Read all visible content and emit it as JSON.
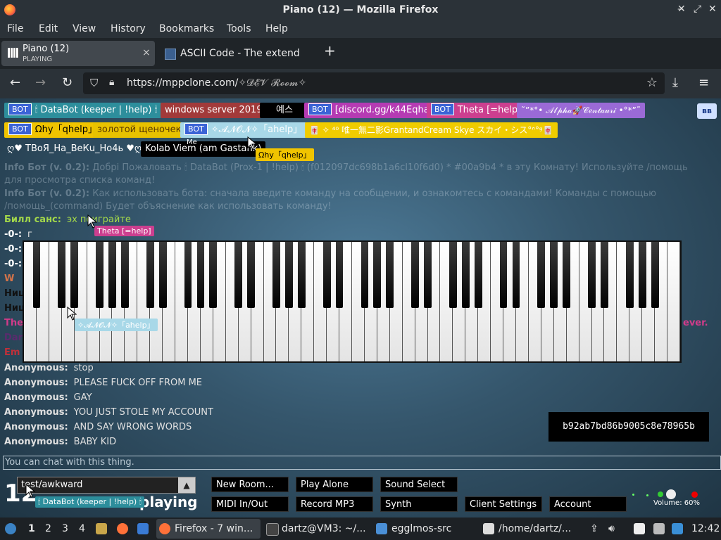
{
  "window": {
    "title": "Piano (12) — Mozilla Firefox"
  },
  "menu": [
    "File",
    "Edit",
    "View",
    "History",
    "Bookmarks",
    "Tools",
    "Help"
  ],
  "tabs": [
    {
      "label": "Piano (12)",
      "sub": "PLAYING",
      "close": "×"
    },
    {
      "label": "ASCII Code - The extended"
    }
  ],
  "newtab": "+",
  "url": {
    "host": "https://mppclone.com/",
    "path": "✧𝓓𝓔𝓥 𝓡𝓸𝓸𝓶✧"
  },
  "translate_badge": "ʙʙ",
  "nametags": [
    {
      "text": "🕯 DataBot (keeper | !help) 🕯",
      "bot": true,
      "bg": "#2d8e9c",
      "fg": "#ffffff"
    },
    {
      "text": "windows server 2019",
      "bot": false,
      "bg": "#a23a3a",
      "fg": "#ffffff"
    },
    {
      "text": "예스",
      "bot": false,
      "bg": "#000000",
      "fg": "#ffffff"
    },
    {
      "text": "[discord.gg/k44Eqha]",
      "bot": true,
      "bg": "#b53bb3",
      "fg": "#ffffff"
    },
    {
      "text": "Theta [=help]",
      "bot": true,
      "bg": "#cc3f8f",
      "fg": "#ffffff"
    },
    {
      "text": "˜”*°• 𝒜𝓁𝓅𝒽𝒶🚀𝒞𝑒𝓃𝓉𝒶𝓊𝓇𝒾 •°*”˜",
      "bot": false,
      "bg": "#9a6ad6",
      "fg": "#ffffff"
    },
    {
      "text": "Ωhy「qhelp」",
      "bot": true,
      "bg": "#f0c400",
      "fg": "#000000"
    },
    {
      "text": "золотой щеночек",
      "bot": false,
      "bg": "#e8c200",
      "fg": "#5a3a00"
    },
    {
      "text": "✧𝓐𝓝𝓞𝓝✧「ahelp」",
      "bot": true,
      "bg": "#a8d8e8",
      "fg": "#ffffff"
    },
    {
      "text": "🀄 ✧ ⁴⁰ 唯一無二影GrantandCream Skye スカイ・シス°ᐢ°ᵍ🀄",
      "bot": false,
      "bg": "#f0cc00",
      "fg": "#ffffff"
    },
    {
      "text": "ღ♥ ТВоЯ_На_ВеКu_Но4ь ♥ღ",
      "bot": false,
      "bg": "transparent",
      "fg": "#ffffff"
    },
    {
      "text": "Kolab Viem (am Gastank)",
      "bot": false,
      "bg": "#000000",
      "fg": "#ffffff"
    }
  ],
  "me_label": "Me",
  "cursor_tags": [
    {
      "text": "Ωhy「qhelp」",
      "bg": "#f0c400",
      "fg": "#000000"
    },
    {
      "text": "Theta [=help]",
      "bg": "#cc3f8f",
      "fg": "#ffffff"
    },
    {
      "text": "✧𝓐𝓝𝓞𝓝✧「ahelp」",
      "bg": "#a8d8e8",
      "fg": "#ffffff"
    },
    {
      "text": "🕯 DataBot (keeper | !help) 🕯",
      "bg": "#2d8e9c",
      "fg": "#ffffff"
    }
  ],
  "ghost_chat": [
    {
      "name": "Info Бот (v. 0.2):",
      "text": "Добрі Пожаловать 🕯 DataBot (Prox-1 | !help) 🕯 (f012097dc698b1a6cl10f6d0) * #00a9b4 * в эту Комнату! Используйте /помощь"
    },
    {
      "name": "",
      "text": "для просмотра списка команд!"
    },
    {
      "name": "Info Бот (v. 0.2):",
      "text": "Как использовать бота: сначала введите команду на сообщении, и ознакомтесь с командами! Команды с помощью"
    },
    {
      "name": "",
      "text": "/помощь_(command) Будет объяснение как использовать команду!"
    }
  ],
  "chat_above": [
    {
      "name": "Билл санс:",
      "text": "эх поиграйте",
      "color": "#a3d84a"
    },
    {
      "name": "-0-:",
      "text": "г",
      "color": "#ffffff"
    },
    {
      "name": "-0-:",
      "text": "",
      "color": "#ffffff"
    },
    {
      "name": "-0-:",
      "text": "",
      "color": "#ffffff"
    },
    {
      "name": "W",
      "text": "",
      "color": "#d5744a"
    },
    {
      "name": "Ниц",
      "text": "",
      "color": "#111111"
    },
    {
      "name": "Ниц",
      "text": "",
      "color": "#111111"
    },
    {
      "name": "The",
      "text": "",
      "color": "#d23b8a"
    },
    {
      "name": "Dar",
      "text": "",
      "color": "#5b2a6e"
    },
    {
      "name": "Em",
      "text": "",
      "color": "#c0303a"
    }
  ],
  "chat_right_fragment": "ever.",
  "chat": [
    {
      "name": "Anonymous:",
      "text": "stop"
    },
    {
      "name": "Anonymous:",
      "text": "PLEASE FUCK OFF FROM ME"
    },
    {
      "name": "Anonymous:",
      "text": "GAY"
    },
    {
      "name": "Anonymous:",
      "text": "YOU JUST STOLE MY ACCOUNT"
    },
    {
      "name": "Anonymous:",
      "text": "AND SAY WRONG WORDS"
    },
    {
      "name": "Anonymous:",
      "text": "BABY KID"
    }
  ],
  "user_id": "b92ab7bd86b9005c8e78965b",
  "chat_placeholder": "You can chat with this thing.",
  "player_count": "12",
  "playing_text": "playing",
  "room_select": {
    "value": "test/awkward",
    "arrow": "▲"
  },
  "buttons": {
    "new_room": "New Room...",
    "play_alone": "Play Alone",
    "sound_select": "Sound Select",
    "midi": "MIDI In/Out",
    "record": "Record MP3",
    "synth": "Synth",
    "client_settings": "Client Settings",
    "account": "Account"
  },
  "volume": "Volume: 60%",
  "taskbar": {
    "workspaces": [
      "1",
      "2",
      "3",
      "4"
    ],
    "items": [
      "Firefox - 7 win...",
      "dartz@VM3: ~/...",
      "egglmos-src",
      "/home/dartz/..."
    ],
    "clock": "12:42"
  }
}
